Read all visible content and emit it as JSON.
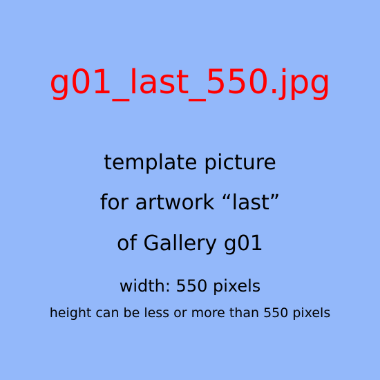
{
  "colors": {
    "background": "#93b8fa",
    "filename_text": "#ff0000",
    "body_text": "#000000"
  },
  "filename": "g01_last_550.jpg",
  "lines": [
    "template picture",
    "for artwork “last”",
    "of Gallery g01",
    "width: 550 pixels",
    "height can be less or more than 550 pixels"
  ]
}
